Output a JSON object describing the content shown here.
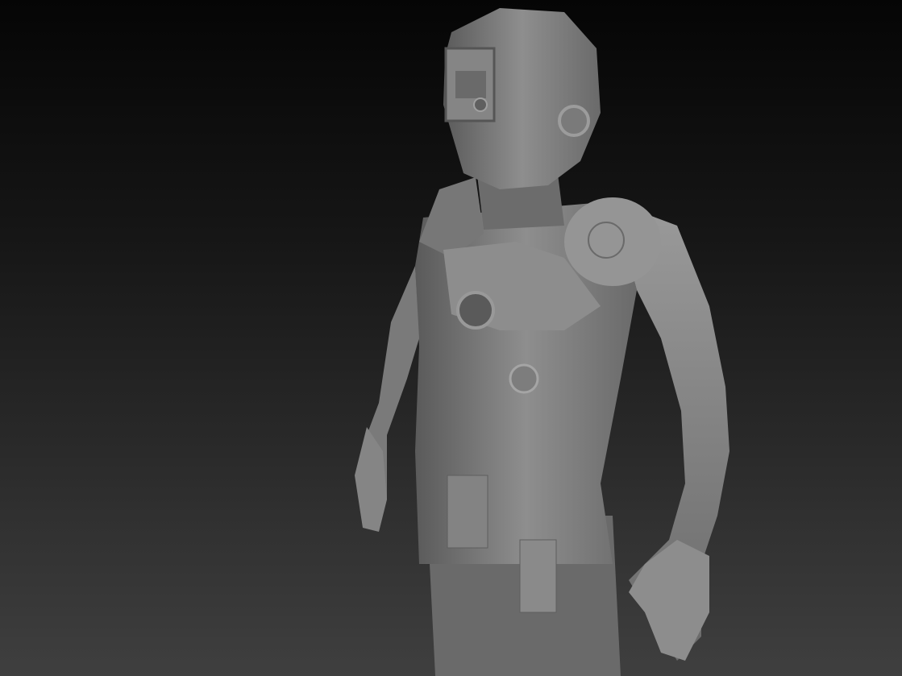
{
  "scene": {
    "subject": "armored-figure-sculpt",
    "colors": {
      "background_top": "#050505",
      "background_bottom": "#3f3f3f",
      "material_light": "#9a9a9a",
      "material_mid": "#6e6e6e",
      "material_dark": "#3a3a3a"
    }
  }
}
